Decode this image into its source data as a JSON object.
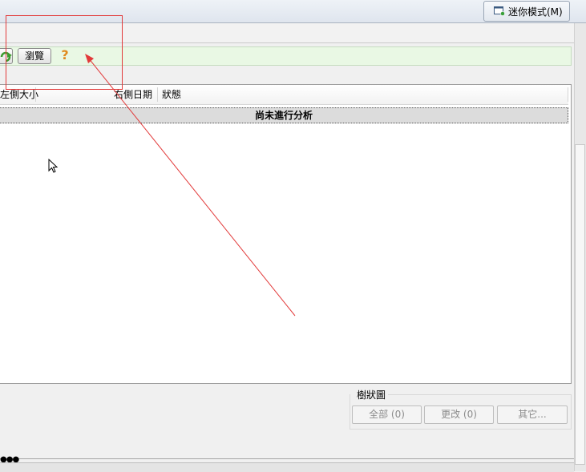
{
  "header": {
    "mini_mode_label": "迷你模式(M)",
    "mini_mode_icon": "window-icon"
  },
  "toolbar": {
    "browse_label": "瀏覽",
    "help_label": "?",
    "refresh_icon": "refresh-icon"
  },
  "file_list": {
    "columns": [
      "左側大小",
      "右側日期",
      "狀態"
    ],
    "status_message": "尚未進行分析"
  },
  "tree_view": {
    "label": "樹狀圖",
    "buttons": [
      "全部 (0)",
      "更改 (0)",
      "其它..."
    ]
  },
  "colors": {
    "path_field_bg": "#e9f8e4",
    "annotation": "#e23a3a",
    "help_icon": "#e08a1e"
  }
}
